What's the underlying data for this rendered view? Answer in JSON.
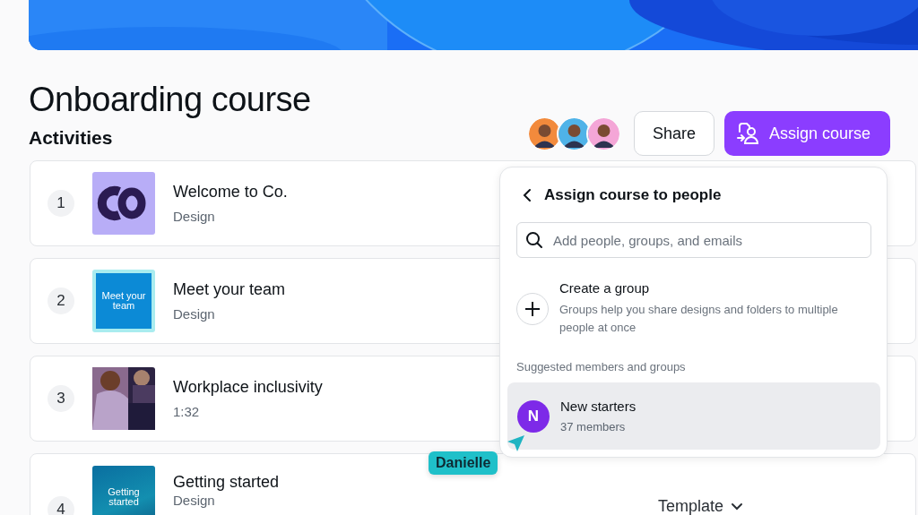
{
  "title": "Onboarding course",
  "section_title": "Activities",
  "collaborators": [
    {
      "color": "#f28a3c"
    },
    {
      "color": "#4fb3e8"
    },
    {
      "color": "#f4a6d7"
    }
  ],
  "buttons": [
    {
      "label": "Share",
      "kind": "secondary"
    },
    {
      "label": "Assign course",
      "kind": "primary"
    }
  ],
  "activities": [
    {
      "number": "1",
      "title": "Welcome to Co.",
      "subtitle": "Design",
      "thumbnail": {
        "kind": "logo"
      }
    },
    {
      "number": "2",
      "title": "Meet your team",
      "subtitle": "Design",
      "thumbnail": {
        "kind": "design",
        "text": "Meet your team"
      }
    },
    {
      "number": "3",
      "title": "Workplace inclusivity",
      "subtitle": "1:32"
    },
    {
      "number": "4",
      "title": "Getting started",
      "subtitle": "Design",
      "thumbnail": {
        "kind": "photo-design",
        "text": "Getting started"
      },
      "type_menu": "Template"
    }
  ],
  "assign_panel": {
    "title": "Assign course to people",
    "search": {
      "placeholder": "Add people, groups, and emails"
    },
    "create_group": {
      "title": "Create a group",
      "description": "Groups help you share designs and folders to multiple people at once"
    },
    "suggested_heading": "Suggested members and groups",
    "suggestions": [
      {
        "initial": "N",
        "name": "New starters",
        "detail": "37 members",
        "selected": true
      }
    ]
  },
  "cursor": {
    "name": "Danielle"
  }
}
